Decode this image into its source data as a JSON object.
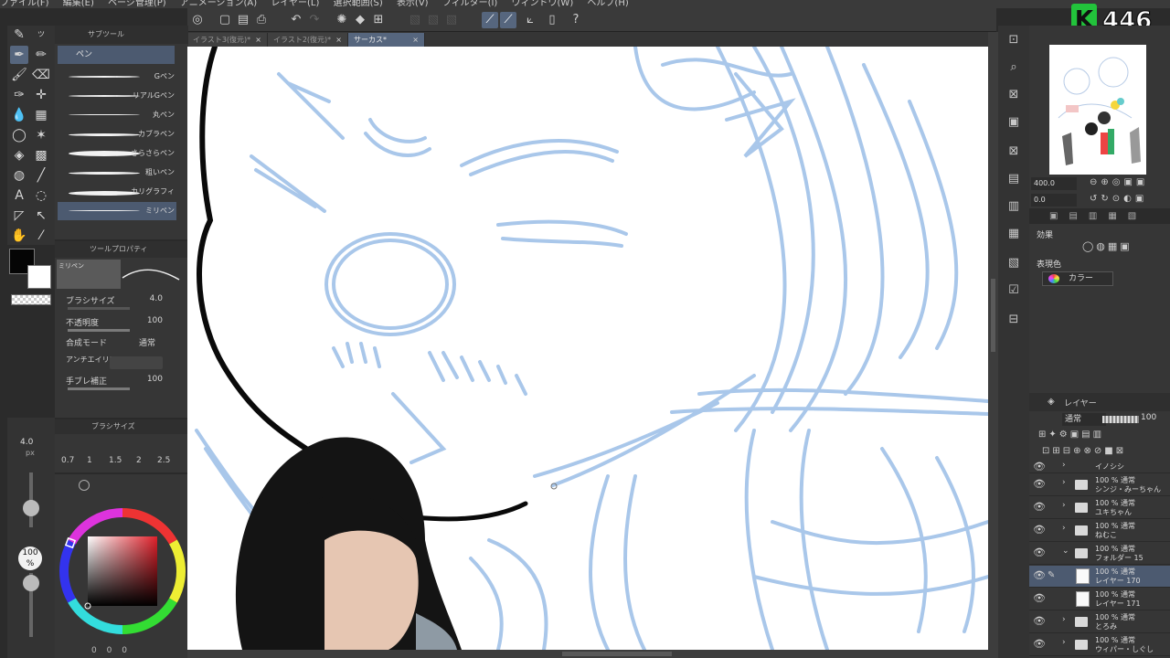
{
  "menu": [
    "ファイル(F)",
    "編集(E)",
    "ページ管理(P)",
    "アニメーション(A)",
    "レイヤー(L)",
    "選択範囲(S)",
    "表示(V)",
    "フィルター(I)",
    "ウィンドウ(W)",
    "ヘルプ(H)"
  ],
  "badge": {
    "letter": "K",
    "number": "446"
  },
  "tabs": [
    {
      "label": "イラスト3(復元)*",
      "close": "×"
    },
    {
      "label": "イラスト2(復元)*",
      "close": "×"
    },
    {
      "label": "サーカス*",
      "close": "×"
    }
  ],
  "subtool": {
    "title": "サブツール",
    "group": "ペン",
    "brushes": [
      "Gペン",
      "リアルGペン",
      "丸ペン",
      "カブラペン",
      "さらさらペン",
      "粗いペン",
      "カリグラフィ",
      "ミリペン"
    ]
  },
  "toolprop": {
    "title": "ツールプロパティ",
    "preset": "ミリペン",
    "rows": [
      {
        "label": "ブラシサイズ",
        "value": "4.0"
      },
      {
        "label": "不透明度",
        "value": "100"
      },
      {
        "label": "合成モード",
        "value": "通常"
      },
      {
        "label": "アンチエイリアス",
        "value": ""
      },
      {
        "label": "手ブレ補正",
        "value": "100"
      }
    ]
  },
  "brushsize": {
    "title": "ブラシサイズ",
    "current": "4.0",
    "unit": "px",
    "sizes": [
      "0.7",
      "1",
      "1.5",
      "2",
      "2.5"
    ]
  },
  "opacity_indicator": {
    "value": "100",
    "unit": "%"
  },
  "color_bottom_values": [
    "0",
    "0",
    "0"
  ],
  "navigator": {
    "zoom": "400.0",
    "rotation": "0.0"
  },
  "effect": {
    "title": "効果",
    "expression_label": "表現色",
    "expression_value": "カラー"
  },
  "layers_panel": {
    "title": "レイヤー",
    "blend": "通常",
    "opacity": "100",
    "items": [
      {
        "t1": "",
        "t2": "イノシシ",
        "type": "folder"
      },
      {
        "t1": "100 % 通常",
        "t2": "シンジ・みーちゃん",
        "type": "folder"
      },
      {
        "t1": "100 % 通常",
        "t2": "ユキちゃん",
        "type": "folder"
      },
      {
        "t1": "100 % 通常",
        "t2": "ねむこ",
        "type": "folder"
      },
      {
        "t1": "100 % 通常",
        "t2": "フォルダー 15",
        "type": "folder-open"
      },
      {
        "t1": "100 % 通常",
        "t2": "レイヤー 170",
        "type": "layer",
        "selected": true
      },
      {
        "t1": "100 % 通常",
        "t2": "レイヤー 171",
        "type": "layer"
      },
      {
        "t1": "100 % 通常",
        "t2": "とろみ",
        "type": "folder"
      },
      {
        "t1": "100 % 通常",
        "t2": "ウィパー・しぐし",
        "type": "folder"
      }
    ]
  },
  "colors": {
    "accent": "#56667e",
    "main_color": "#050505",
    "sub_color": "#ffffff",
    "sketch_blue": "#a9c7ea"
  }
}
